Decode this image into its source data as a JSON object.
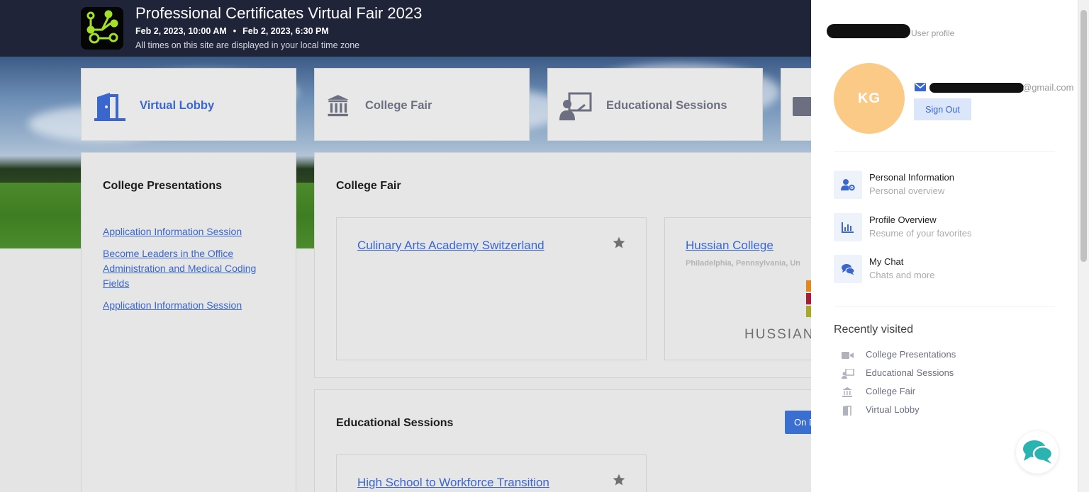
{
  "header": {
    "title": "Professional Certificates Virtual Fair 2023",
    "start": "Feb 2, 2023, 10:00 AM",
    "separator": "•",
    "end": "Feb 2, 2023, 6:30 PM",
    "timezone_note": "All times on this site are displayed in your local time zone",
    "logo_icon": "network-nodes-logo"
  },
  "nav": [
    {
      "label": "Virtual Lobby",
      "icon": "door-icon",
      "active": true
    },
    {
      "label": "College Fair",
      "icon": "institution-icon",
      "active": false
    },
    {
      "label": "Educational Sessions",
      "icon": "presenter-icon",
      "active": false
    }
  ],
  "presentations": {
    "title": "College Presentations",
    "links": [
      "Application Information Session",
      "Become Leaders in the Office Administration and Medical Coding Fields",
      "Application Information Session"
    ]
  },
  "fair": {
    "title": "College Fair",
    "cards": [
      {
        "name": "Culinary Arts Academy Switzerland",
        "location": ""
      },
      {
        "name": "Hussian College",
        "location": "Philadelphia, Pennsylvania, Un",
        "logo_text": "HUSSIAN"
      }
    ]
  },
  "sessions": {
    "title": "Educational Sessions",
    "button": "On D",
    "cards": [
      {
        "name": "High School to Workforce Transition"
      }
    ]
  },
  "profile": {
    "user_profile_label": "User profile",
    "initials": "KG",
    "email_suffix": "@gmail.com",
    "sign_out": "Sign Out",
    "menu": [
      {
        "title": "Personal Information",
        "subtitle": "Personal overview",
        "icon": "user-gear-icon"
      },
      {
        "title": "Profile Overview",
        "subtitle": "Resume of your favorites",
        "icon": "bar-chart-icon"
      },
      {
        "title": "My Chat",
        "subtitle": "Chats and more",
        "icon": "chat-bubbles-icon"
      }
    ],
    "recent_title": "Recently visited",
    "recent": [
      {
        "label": "College Presentations",
        "icon": "video-camera-icon"
      },
      {
        "label": "Educational Sessions",
        "icon": "presenter-icon"
      },
      {
        "label": "College Fair",
        "icon": "institution-icon"
      },
      {
        "label": "Virtual Lobby",
        "icon": "door-icon"
      }
    ]
  },
  "colors": {
    "header_bg": "#1f2438",
    "accent": "#3a66d0",
    "avatar_bg": "#fcca87",
    "chat_fab": "#2ab3b0"
  }
}
